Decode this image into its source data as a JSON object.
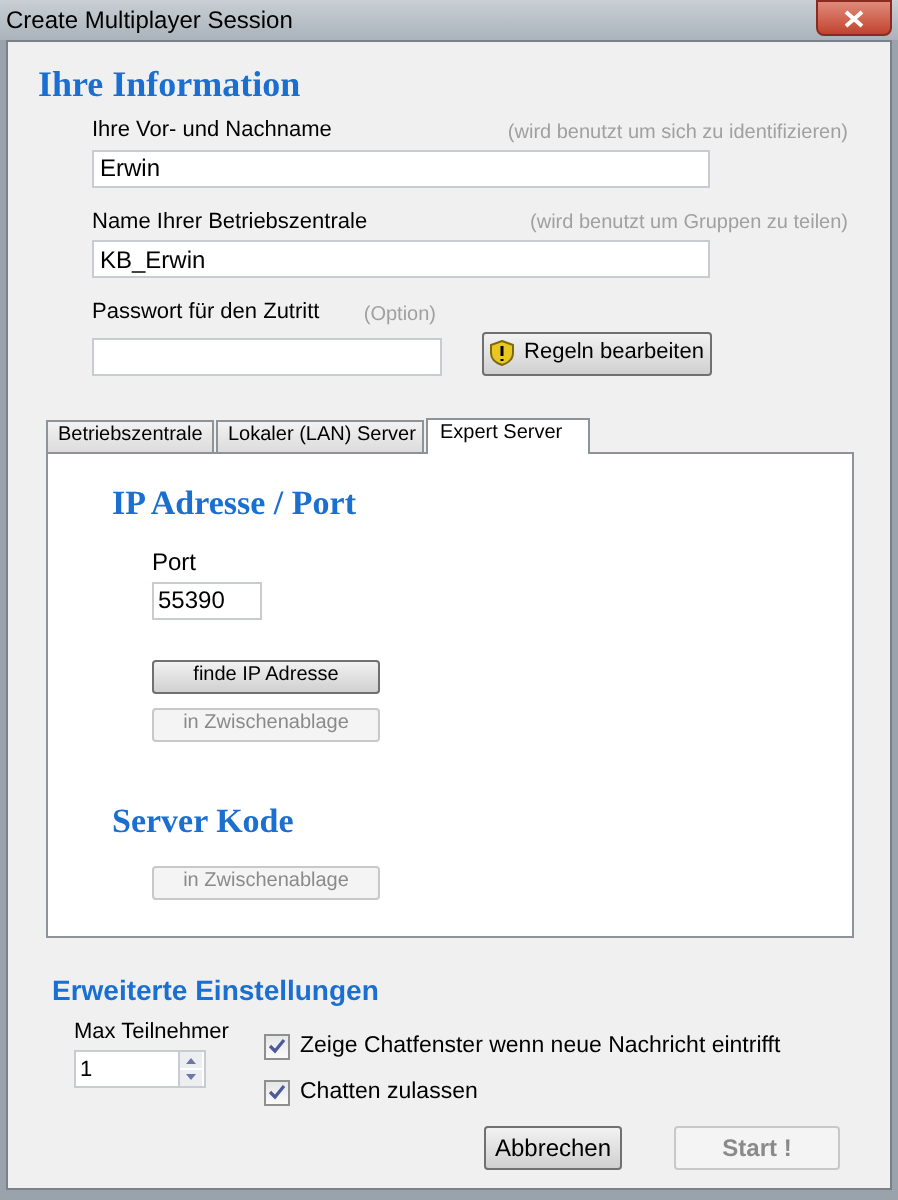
{
  "window": {
    "title": "Create Multiplayer Session"
  },
  "info": {
    "heading": "Ihre Information",
    "fields": [
      {
        "label": "Ihre Vor- und Nachname",
        "hint": "(wird benutzt um sich zu identifizieren)",
        "value": "Erwin"
      },
      {
        "label": "Name Ihrer Betriebszentrale",
        "hint": "(wird benutzt um Gruppen zu teilen)",
        "value": "KB_Erwin"
      },
      {
        "label": "Passwort für den Zutritt",
        "hint": "(Option)"
      }
    ],
    "rules_button": "Regeln bearbeiten"
  },
  "tabs": [
    {
      "label": "Betriebszentrale",
      "selected": false
    },
    {
      "label": "Lokaler (LAN) Server",
      "selected": false
    },
    {
      "label": "Expert Server",
      "selected": true
    }
  ],
  "expert": {
    "ip_heading": "IP Adresse / Port",
    "port_label": "Port",
    "port_value": "55390",
    "find_button": {
      "label": "finde IP Adresse",
      "disabled": false
    },
    "copy_button": {
      "label": "in Zwischenablage",
      "disabled": true
    },
    "code_heading": "Server Kode",
    "code_copy_button": {
      "label": "in Zwischenablage",
      "disabled": true
    }
  },
  "advanced": {
    "heading": "Erweiterte Einstellungen",
    "max_label": "Max Teilnehmer",
    "max_value": "1",
    "options": [
      {
        "label": "Zeige Chatfenster wenn neue Nachricht eintrifft",
        "checked": true
      },
      {
        "label": "Chatten zulassen",
        "checked": true
      }
    ]
  },
  "buttons": [
    {
      "label": "Abbrechen",
      "disabled": false
    },
    {
      "label": "Start !",
      "disabled": true
    }
  ]
}
